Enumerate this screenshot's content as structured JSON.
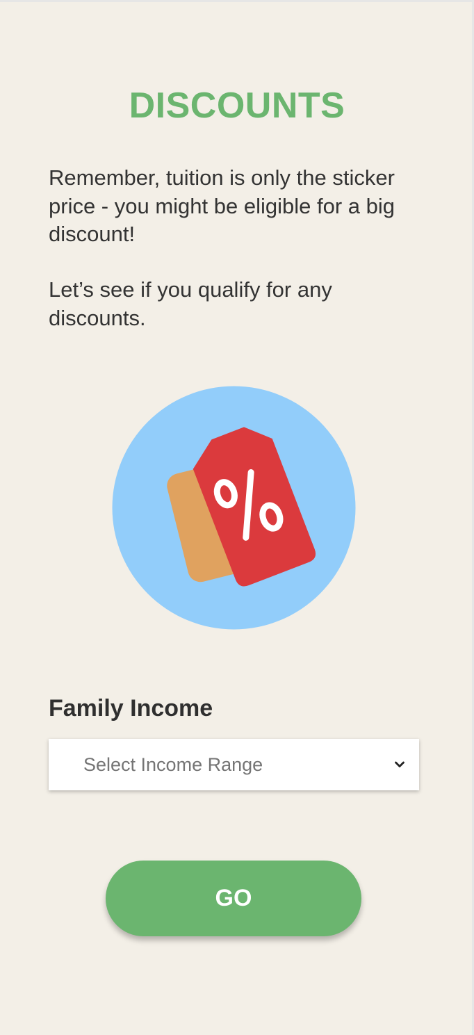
{
  "header": {
    "title": "DISCOUNTS"
  },
  "content": {
    "intro_text": "Remember, tuition is only the sticker price - you might be eligible for a big discount!",
    "qualify_text": "Let’s see if you qualify for any discounts."
  },
  "illustration": {
    "icon": "discount-tag-icon",
    "symbol": "%",
    "colors": {
      "circle": "#92cdfa",
      "front_tag": "#db3a3d",
      "back_tag": "#e0a25f",
      "symbol": "#ffffff"
    }
  },
  "form": {
    "income_label": "Family Income",
    "income_select": {
      "placeholder": "Select Income Range",
      "icon": "chevron-down-icon"
    },
    "go_label": "GO"
  },
  "colors": {
    "background": "#f3efe7",
    "accent": "#6bb56f",
    "text": "#2f2f2f"
  }
}
